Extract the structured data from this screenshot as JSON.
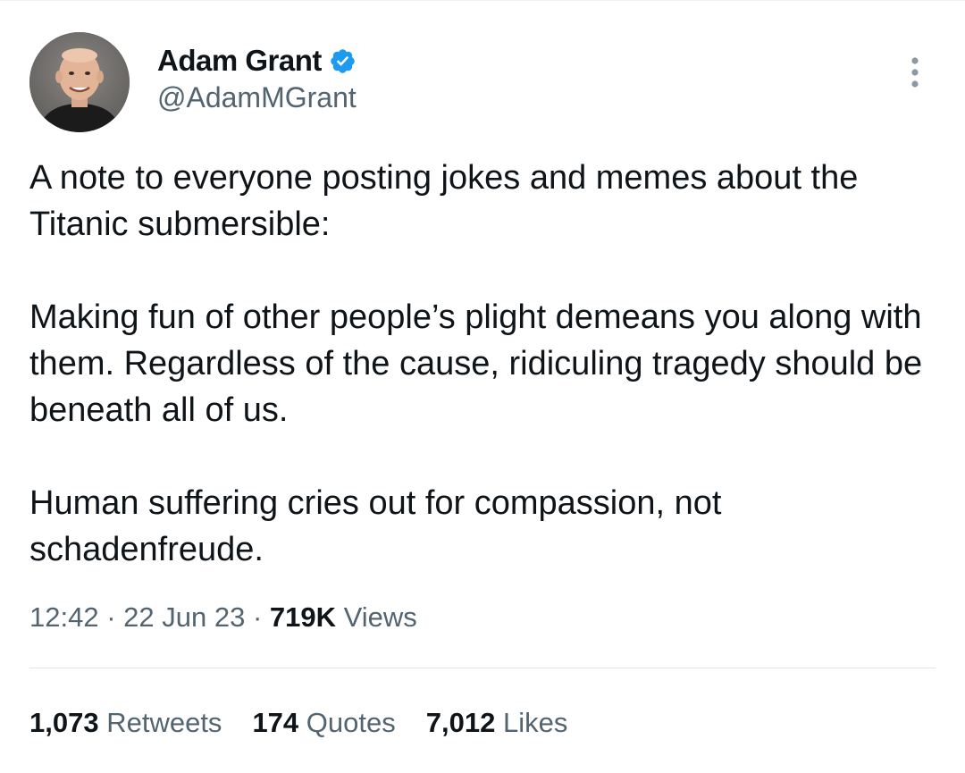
{
  "author": {
    "display_name": "Adam Grant",
    "handle": "@AdamMGrant",
    "verified": true,
    "verified_color": "#1d9bf0"
  },
  "tweet": {
    "paragraphs": [
      "A note to everyone posting jokes and memes about the Titanic submersible:",
      "Making fun of other people’s plight demeans you along with them. Regardless of the cause, ridiculing tragedy should be beneath all of us.",
      "Human suffering cries out for compassion, not schadenfreude."
    ],
    "time": "12:42",
    "separator": "·",
    "date": "22 Jun 23",
    "views_count": "719K",
    "views_label": "Views"
  },
  "stats": {
    "retweets_count": "1,073",
    "retweets_label": "Retweets",
    "quotes_count": "174",
    "quotes_label": "Quotes",
    "likes_count": "7,012",
    "likes_label": "Likes"
  },
  "icons": {
    "verified": "verified-badge-icon",
    "more": "more-options-icon"
  }
}
